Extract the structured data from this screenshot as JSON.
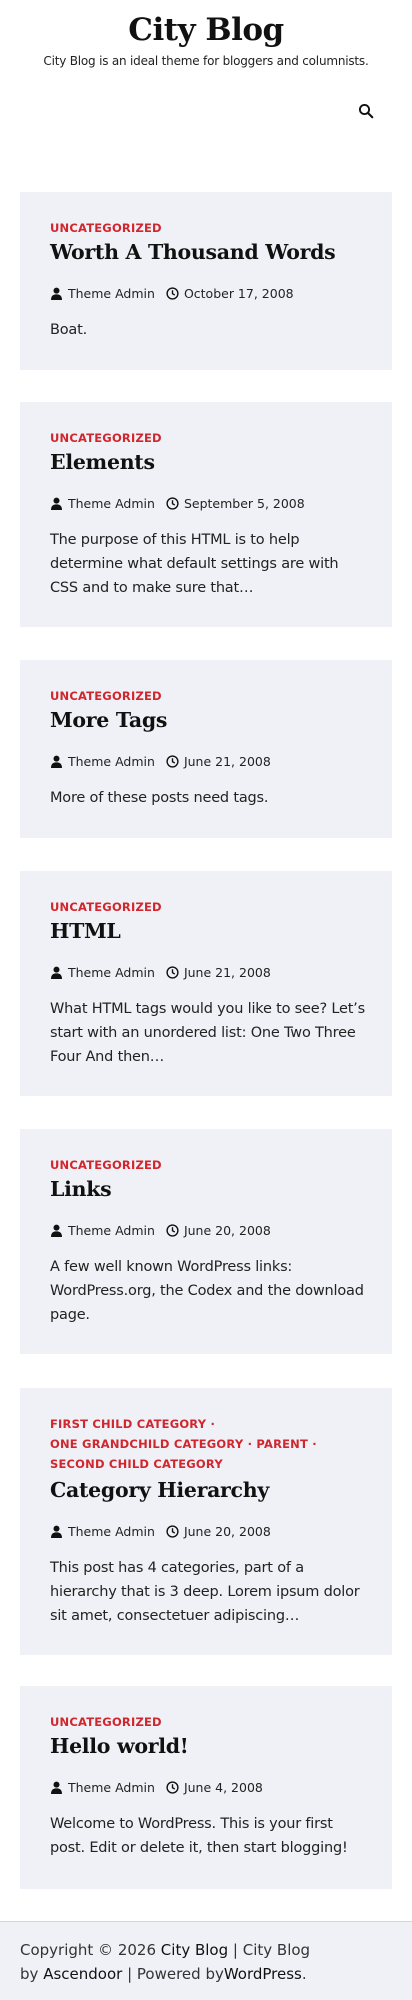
{
  "header": {
    "site_title": "City Blog",
    "tagline": "City Blog is an ideal theme for bloggers and columnists."
  },
  "posts": [
    {
      "categories": [
        "UNCATEGORIZED"
      ],
      "title": "Worth A Thousand Words",
      "author": "Theme Admin",
      "date": "October 17, 2008",
      "excerpt": "Boat."
    },
    {
      "categories": [
        "UNCATEGORIZED"
      ],
      "title": "Elements",
      "author": "Theme Admin",
      "date": "September 5, 2008",
      "excerpt": "The purpose of this HTML is to help determine what default settings are with CSS and to make sure that…"
    },
    {
      "categories": [
        "UNCATEGORIZED"
      ],
      "title": "More Tags",
      "author": "Theme Admin",
      "date": "June 21, 2008",
      "excerpt": "More of these posts need tags."
    },
    {
      "categories": [
        "UNCATEGORIZED"
      ],
      "title": "HTML",
      "author": "Theme Admin",
      "date": "June 21, 2008",
      "excerpt": "What HTML tags would you like to see? Let’s start with an unordered list: One Two Three Four And then…"
    },
    {
      "categories": [
        "UNCATEGORIZED"
      ],
      "title": "Links",
      "author": "Theme Admin",
      "date": "June 20, 2008",
      "excerpt": "A few well known WordPress links: WordPress.org, the Codex and the download page."
    },
    {
      "categories": [
        "FIRST CHILD CATEGORY",
        "ONE GRANDCHILD CATEGORY",
        "PARENT",
        "SECOND CHILD CATEGORY"
      ],
      "title": "Category Hierarchy",
      "author": "Theme Admin",
      "date": "June 20, 2008",
      "excerpt": "This post has 4 categories, part of a hierarchy that is 3 deep. Lorem ipsum dolor sit amet, consectetuer adipiscing…"
    },
    {
      "categories": [
        "UNCATEGORIZED"
      ],
      "title": "Hello world!",
      "author": "Theme Admin",
      "date": "June 4, 2008",
      "excerpt": "Welcome to WordPress. This is your first post. Edit or delete it, then start blogging!"
    }
  ],
  "category_separator": "·",
  "footer": {
    "copyright": "Copyright © 2026",
    "site_link": "City Blog",
    "divider": "|",
    "theme_prefix": "City Blog by",
    "theme_author": "Ascendoor",
    "powered_prefix": "| Powered by",
    "powered_link": "WordPress",
    "end": "."
  }
}
